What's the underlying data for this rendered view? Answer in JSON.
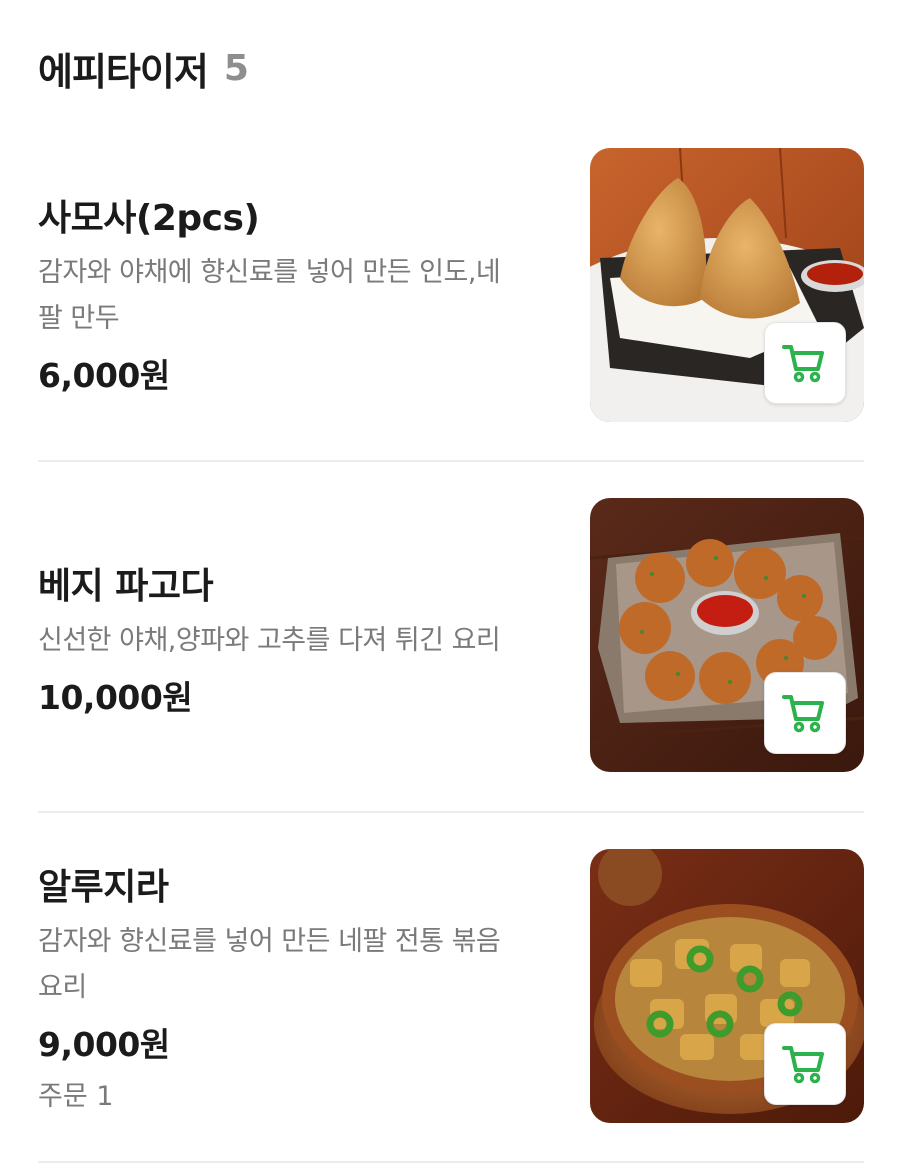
{
  "section": {
    "title": "에피타이저",
    "count": "5"
  },
  "colors": {
    "accent": "#2bb24c",
    "text_primary": "#1b1b1b",
    "text_secondary": "#7a7a7a",
    "divider": "#ececec"
  },
  "items": [
    {
      "name": "사모사(2pcs)",
      "desc_lines": [
        "감자와 야채에 향신료를 넣어 만든 인도,네",
        "팔 만두"
      ],
      "price": "6,000원",
      "order": "",
      "image_icon": "samosa-photo",
      "cart_icon": "cart-icon"
    },
    {
      "name": "베지 파고다",
      "desc_lines": [
        "신선한 야채,양파와 고추를 다져 튀긴 요리"
      ],
      "price": "10,000원",
      "order": "",
      "image_icon": "veg-pakoda-photo",
      "cart_icon": "cart-icon"
    },
    {
      "name": "알루지라",
      "desc_lines": [
        "감자와 향신료를 넣어 만든 네팔 전통 볶음",
        "요리"
      ],
      "price": "9,000원",
      "order": "주문 1",
      "image_icon": "aloo-jeera-photo",
      "cart_icon": "cart-icon"
    }
  ]
}
